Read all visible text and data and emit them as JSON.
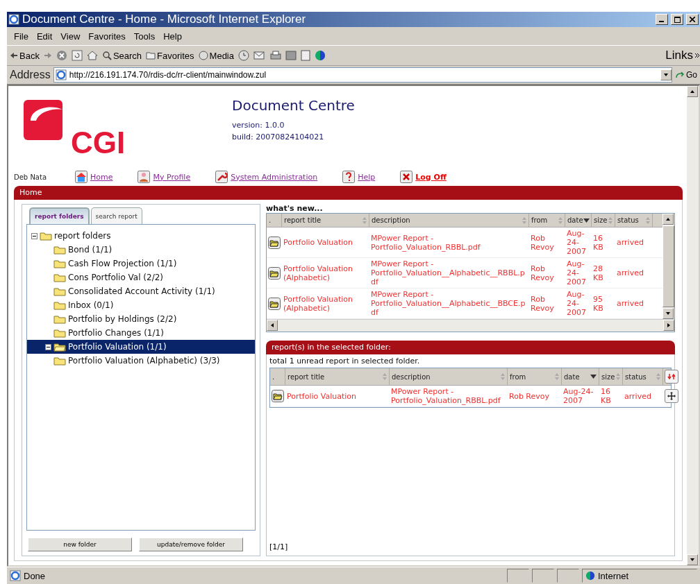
{
  "window": {
    "title": "Document Centre - Home - Microsoft Internet Explorer"
  },
  "menu": [
    "File",
    "Edit",
    "View",
    "Favorites",
    "Tools",
    "Help"
  ],
  "toolbar": {
    "back": "Back",
    "search": "Search",
    "favorites": "Favorites",
    "media": "Media",
    "links": "Links"
  },
  "address": {
    "label": "Address",
    "url": "http://216.191.174.70/rdis-dc/rr-client/mainwindow.zul",
    "go": "Go"
  },
  "page": {
    "logo_text": "CGI",
    "app_title": "Document Centre",
    "version": "version: 1.0.0",
    "build": "build: 20070824104021",
    "user": "Deb Nata",
    "nav": [
      {
        "label": "Home",
        "kind": "home"
      },
      {
        "label": "My Profile",
        "kind": "profile"
      },
      {
        "label": "System Administration",
        "kind": "admin"
      },
      {
        "label": "Help",
        "kind": "help"
      },
      {
        "label": "Log Off",
        "kind": "logoff"
      }
    ],
    "breadcrumb": "Home",
    "tabs": [
      {
        "label": "report folders",
        "selected": true
      },
      {
        "label": "search report",
        "selected": false
      }
    ],
    "tree": {
      "label": "report folders",
      "expanded": true,
      "children": [
        {
          "label": "Bond (1/1)",
          "selected": false,
          "expanded": false
        },
        {
          "label": "Cash Flow Projection (1/1)",
          "selected": false,
          "expanded": false
        },
        {
          "label": "Cons Portfolio Val (2/2)",
          "selected": false,
          "expanded": false
        },
        {
          "label": "Consolidated Account Activity (1/1)",
          "selected": false,
          "expanded": false
        },
        {
          "label": "Inbox (0/1)",
          "selected": false,
          "expanded": false
        },
        {
          "label": "Portfolio by Holdings (2/2)",
          "selected": false,
          "expanded": false
        },
        {
          "label": "Portfolio Changes (1/1)",
          "selected": false,
          "expanded": false
        },
        {
          "label": "Portfolio Valuation (1/1)",
          "selected": true,
          "expanded": true
        },
        {
          "label": "Portfolio Valuation (Alphabetic) (3/3)",
          "selected": false,
          "expanded": false
        }
      ]
    },
    "buttons": [
      "new folder",
      "update/remove folder"
    ],
    "whats_new": {
      "title": "what's new...",
      "columns": [
        {
          "label": ".",
          "sorted": false
        },
        {
          "label": "report title",
          "sorted": false
        },
        {
          "label": "description",
          "sorted": false
        },
        {
          "label": "from",
          "sorted": false
        },
        {
          "label": "date",
          "sorted": true
        },
        {
          "label": "size",
          "sorted": false
        },
        {
          "label": "status",
          "sorted": false
        }
      ],
      "rows": [
        [
          "",
          "Portfolio Valuation",
          "MPower Report - Portfolio_Valuation_RBBL.pdf",
          "Rob Revoy",
          "Aug-24-2007",
          "16 KB",
          "arrived"
        ],
        [
          "",
          "Portfolio Valuation (Alphabetic)",
          "MPower Report - Portfolio_Valuation__Alphabetic__RBBL.pdf",
          "Rob Revoy",
          "Aug-24-2007",
          "28 KB",
          "arrived"
        ],
        [
          "",
          "Portfolio Valuation (Alphabetic)",
          "MPower Report - Portfolio_Valuation__Alphabetic__BBCE.pdf",
          "Rob Revoy",
          "Aug-24-2007",
          "95 KB",
          "arrived"
        ]
      ]
    },
    "selected_folder": {
      "title": "report(s) in the selected folder:",
      "summary": "total 1 unread report in selected folder.",
      "columns": [
        {
          "label": ".",
          "sorted": false
        },
        {
          "label": "report title",
          "sorted": false
        },
        {
          "label": "description",
          "sorted": false
        },
        {
          "label": "from",
          "sorted": false
        },
        {
          "label": "date",
          "sorted": true
        },
        {
          "label": "size",
          "sorted": false
        },
        {
          "label": "status",
          "sorted": false
        }
      ],
      "rows": [
        [
          "",
          "Portfolio Valuation",
          "MPower Report - Portfolio_Valuation_RBBL.pdf",
          "Rob Revoy",
          "Aug-24-2007",
          "16 KB",
          "arrived"
        ]
      ],
      "pager": "[1/1]"
    }
  },
  "status_bar": {
    "text": "Done",
    "zone": "Internet"
  }
}
